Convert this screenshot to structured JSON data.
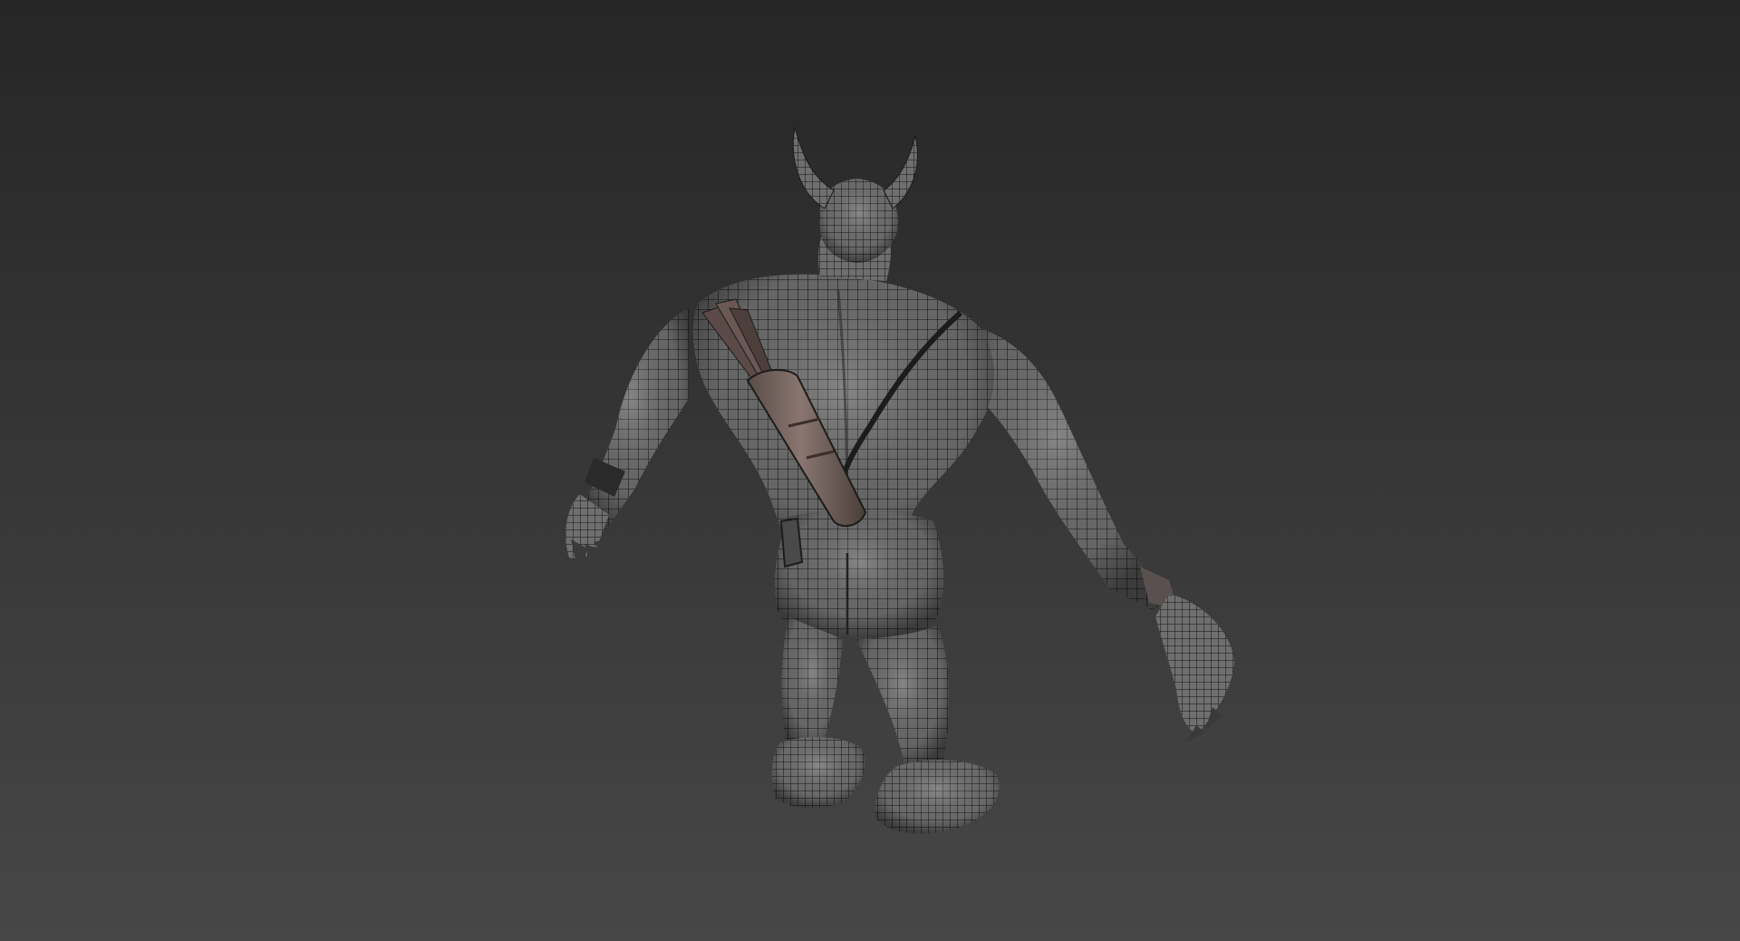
{
  "viewport": {
    "background_top": "#262626",
    "background_bottom": "#474747",
    "render_mode": "shaded-with-wireframe"
  },
  "model": {
    "subject": "horned-creature-back-view",
    "mesh_color": "#6a6a6a",
    "wire_color": "#111111",
    "accessories": [
      "quiver",
      "arrows",
      "strap",
      "belt-pouch",
      "bracers",
      "claws",
      "horns"
    ]
  }
}
